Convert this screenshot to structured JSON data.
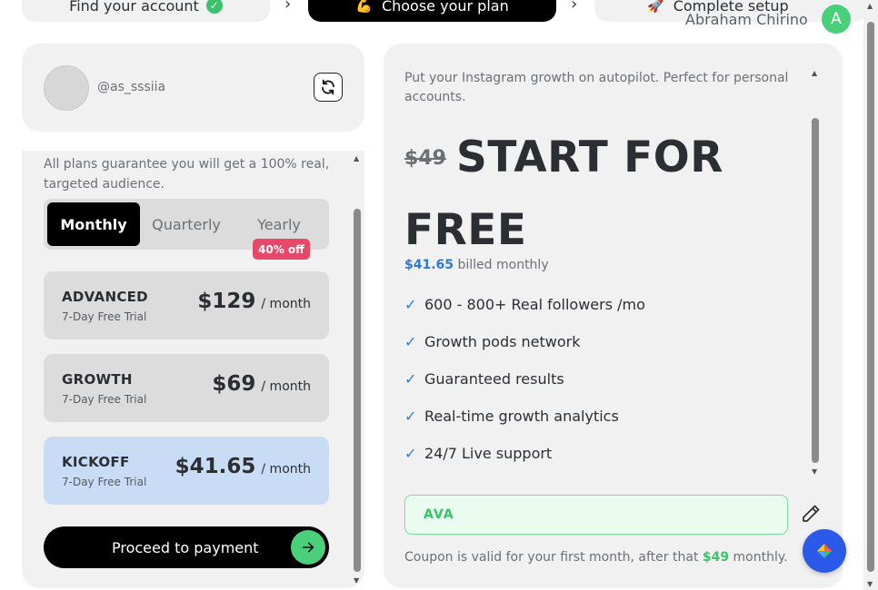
{
  "stepper": {
    "step1": "Find your account",
    "step2": "Choose your plan",
    "step3": "Complete setup"
  },
  "user": {
    "name": "Abraham Chirino",
    "initial": "A"
  },
  "account": {
    "handle": "@as_sssiia"
  },
  "plans": {
    "description": "All plans guarantee you will get a 100% real, targeted audience.",
    "periods": [
      "Monthly",
      "Quarterly",
      "Yearly"
    ],
    "selected_period": "Monthly",
    "discount_badge": "40% off",
    "items": [
      {
        "name": "ADVANCED",
        "trial": "7-Day Free Trial",
        "price": "$129",
        "period": "/ month"
      },
      {
        "name": "GROWTH",
        "trial": "7-Day Free Trial",
        "price": "$69",
        "period": "/ month"
      },
      {
        "name": "KICKOFF",
        "trial": "7-Day Free Trial",
        "price": "$41.65",
        "period": "/ month"
      }
    ],
    "selected_plan": "KICKOFF",
    "proceed_label": "Proceed to payment"
  },
  "summary": {
    "description": "Put your Instagram growth on autopilot. Perfect for personal accounts.",
    "old_price": "$49",
    "headline": "START FOR FREE",
    "billed_amount": "$41.65",
    "billed_suffix": " billed monthly",
    "features": [
      "600 - 800+ Real followers /mo",
      "Growth pods network",
      "Guaranteed results",
      "Real-time growth analytics",
      "24/7 Live support"
    ],
    "coupon_code": "AVA",
    "coupon_note_prefix": "Coupon is valid for your first month, after that ",
    "coupon_note_amount": "$49",
    "coupon_note_suffix": " monthly."
  },
  "colors": {
    "accent_green": "#4ad07a",
    "accent_blue": "#2f7ad6",
    "selected_plan_bg": "#c9dcf6",
    "badge_red": "#e8476a"
  }
}
